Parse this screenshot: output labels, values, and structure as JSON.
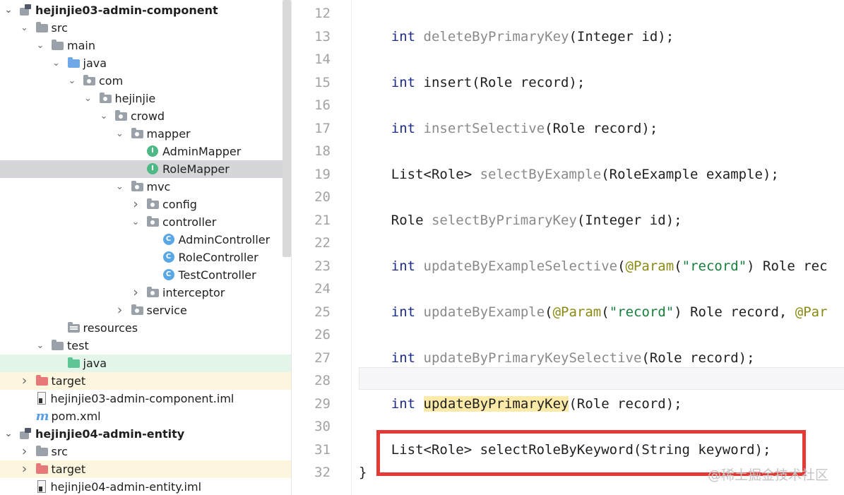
{
  "tree": [
    {
      "label": "hejinjie03-admin-component",
      "depth": 0,
      "icon": "module-icon",
      "expand": "down",
      "bold": true
    },
    {
      "label": "src",
      "depth": 1,
      "icon": "folder-gray",
      "expand": "down"
    },
    {
      "label": "main",
      "depth": 2,
      "icon": "folder-gray",
      "expand": "down"
    },
    {
      "label": "java",
      "depth": 3,
      "icon": "folder-blue",
      "expand": "down"
    },
    {
      "label": "com",
      "depth": 4,
      "icon": "package-icon",
      "expand": "down"
    },
    {
      "label": "hejinjie",
      "depth": 5,
      "icon": "package-icon",
      "expand": "down"
    },
    {
      "label": "crowd",
      "depth": 6,
      "icon": "package-icon",
      "expand": "down"
    },
    {
      "label": "mapper",
      "depth": 7,
      "icon": "package-icon",
      "expand": "down"
    },
    {
      "label": "AdminMapper",
      "depth": 8,
      "icon": "interface-icon",
      "expand": "none"
    },
    {
      "label": "RoleMapper",
      "depth": 8,
      "icon": "interface-icon",
      "expand": "none",
      "selected": true
    },
    {
      "label": "mvc",
      "depth": 7,
      "icon": "package-icon",
      "expand": "down"
    },
    {
      "label": "config",
      "depth": 8,
      "icon": "package-icon",
      "expand": "right"
    },
    {
      "label": "controller",
      "depth": 8,
      "icon": "package-icon",
      "expand": "down"
    },
    {
      "label": "AdminController",
      "depth": 9,
      "icon": "class-icon",
      "expand": "none"
    },
    {
      "label": "RoleController",
      "depth": 9,
      "icon": "class-icon",
      "expand": "none"
    },
    {
      "label": "TestController",
      "depth": 9,
      "icon": "class-icon",
      "expand": "none"
    },
    {
      "label": "interceptor",
      "depth": 8,
      "icon": "package-icon",
      "expand": "right"
    },
    {
      "label": "service",
      "depth": 7,
      "icon": "package-icon",
      "expand": "right"
    },
    {
      "label": "resources",
      "depth": 3,
      "icon": "resources-icon",
      "expand": "none"
    },
    {
      "label": "test",
      "depth": 2,
      "icon": "folder-gray",
      "expand": "down"
    },
    {
      "label": "java",
      "depth": 3,
      "icon": "folder-green",
      "expand": "none",
      "row": "green"
    },
    {
      "label": "target",
      "depth": 1,
      "icon": "folder-red",
      "expand": "right",
      "row": "yellow"
    },
    {
      "label": "hejinjie03-admin-component.iml",
      "depth": 1,
      "icon": "iml-icon",
      "expand": "none"
    },
    {
      "label": "pom.xml",
      "depth": 1,
      "icon": "maven-icon",
      "expand": "none"
    },
    {
      "label": "hejinjie04-admin-entity",
      "depth": 0,
      "icon": "module-icon",
      "expand": "down",
      "bold": true
    },
    {
      "label": "src",
      "depth": 1,
      "icon": "folder-gray",
      "expand": "right"
    },
    {
      "label": "target",
      "depth": 1,
      "icon": "folder-red",
      "expand": "right",
      "row": "yellow"
    },
    {
      "label": "hejinjie04-admin-entity.iml",
      "depth": 1,
      "icon": "iml-icon",
      "expand": "none"
    }
  ],
  "maven_glyph": "m",
  "code": [
    {
      "line": "12",
      "segments": []
    },
    {
      "line": "13",
      "segments": [
        {
          "t": "    "
        },
        {
          "t": "int",
          "c": "kw"
        },
        {
          "t": " "
        },
        {
          "t": "deleteByPrimaryKey",
          "c": "gm"
        },
        {
          "t": "(Integer id);"
        }
      ]
    },
    {
      "line": "14",
      "segments": []
    },
    {
      "line": "15",
      "segments": [
        {
          "t": "    "
        },
        {
          "t": "int",
          "c": "kw"
        },
        {
          "t": " insert(Role record);"
        }
      ]
    },
    {
      "line": "16",
      "segments": []
    },
    {
      "line": "17",
      "segments": [
        {
          "t": "    "
        },
        {
          "t": "int",
          "c": "kw"
        },
        {
          "t": " "
        },
        {
          "t": "insertSelective",
          "c": "gm"
        },
        {
          "t": "(Role record);"
        }
      ]
    },
    {
      "line": "18",
      "segments": []
    },
    {
      "line": "19",
      "segments": [
        {
          "t": "    List<Role> "
        },
        {
          "t": "selectByExample",
          "c": "gm"
        },
        {
          "t": "(RoleExample example);"
        }
      ]
    },
    {
      "line": "20",
      "segments": []
    },
    {
      "line": "21",
      "segments": [
        {
          "t": "    Role "
        },
        {
          "t": "selectByPrimaryKey",
          "c": "gm"
        },
        {
          "t": "(Integer id);"
        }
      ]
    },
    {
      "line": "22",
      "segments": []
    },
    {
      "line": "23",
      "segments": [
        {
          "t": "    "
        },
        {
          "t": "int",
          "c": "kw"
        },
        {
          "t": " "
        },
        {
          "t": "updateByExampleSelective",
          "c": "gm"
        },
        {
          "t": "("
        },
        {
          "t": "@Param",
          "c": "an"
        },
        {
          "t": "("
        },
        {
          "t": "\"record\"",
          "c": "st"
        },
        {
          "t": ") Role rec"
        }
      ]
    },
    {
      "line": "24",
      "segments": []
    },
    {
      "line": "25",
      "segments": [
        {
          "t": "    "
        },
        {
          "t": "int",
          "c": "kw"
        },
        {
          "t": " "
        },
        {
          "t": "updateByExample",
          "c": "gm"
        },
        {
          "t": "("
        },
        {
          "t": "@Param",
          "c": "an"
        },
        {
          "t": "("
        },
        {
          "t": "\"record\"",
          "c": "st"
        },
        {
          "t": ") Role record, "
        },
        {
          "t": "@Par",
          "c": "an"
        }
      ]
    },
    {
      "line": "26",
      "segments": []
    },
    {
      "line": "27",
      "segments": [
        {
          "t": "    "
        },
        {
          "t": "int",
          "c": "kw"
        },
        {
          "t": " "
        },
        {
          "t": "updateByPrimaryKeySelective",
          "c": "gm"
        },
        {
          "t": "(Role record);"
        }
      ]
    },
    {
      "line": "28",
      "segments": [],
      "current": true
    },
    {
      "line": "29",
      "segments": [
        {
          "t": "    "
        },
        {
          "t": "int",
          "c": "kw"
        },
        {
          "t": " "
        },
        {
          "t": "updateByPrimaryKey",
          "c": "hl"
        },
        {
          "t": "(Role record);"
        }
      ]
    },
    {
      "line": "30",
      "segments": []
    },
    {
      "line": "31",
      "segments": [
        {
          "t": "    List<Role> selectRoleByKeyword(String keyword);"
        }
      ]
    },
    {
      "line": "32",
      "segments": [
        {
          "t": "}"
        }
      ]
    }
  ],
  "watermark": "@稀土掘金技术社区",
  "colors": {
    "keyword": "#1c2c8c",
    "unused_method": "#8a8a8a",
    "annotation": "#8a8a14",
    "string": "#167f3c",
    "highlight_box": "#e53935",
    "selection": "#d4d6da"
  }
}
